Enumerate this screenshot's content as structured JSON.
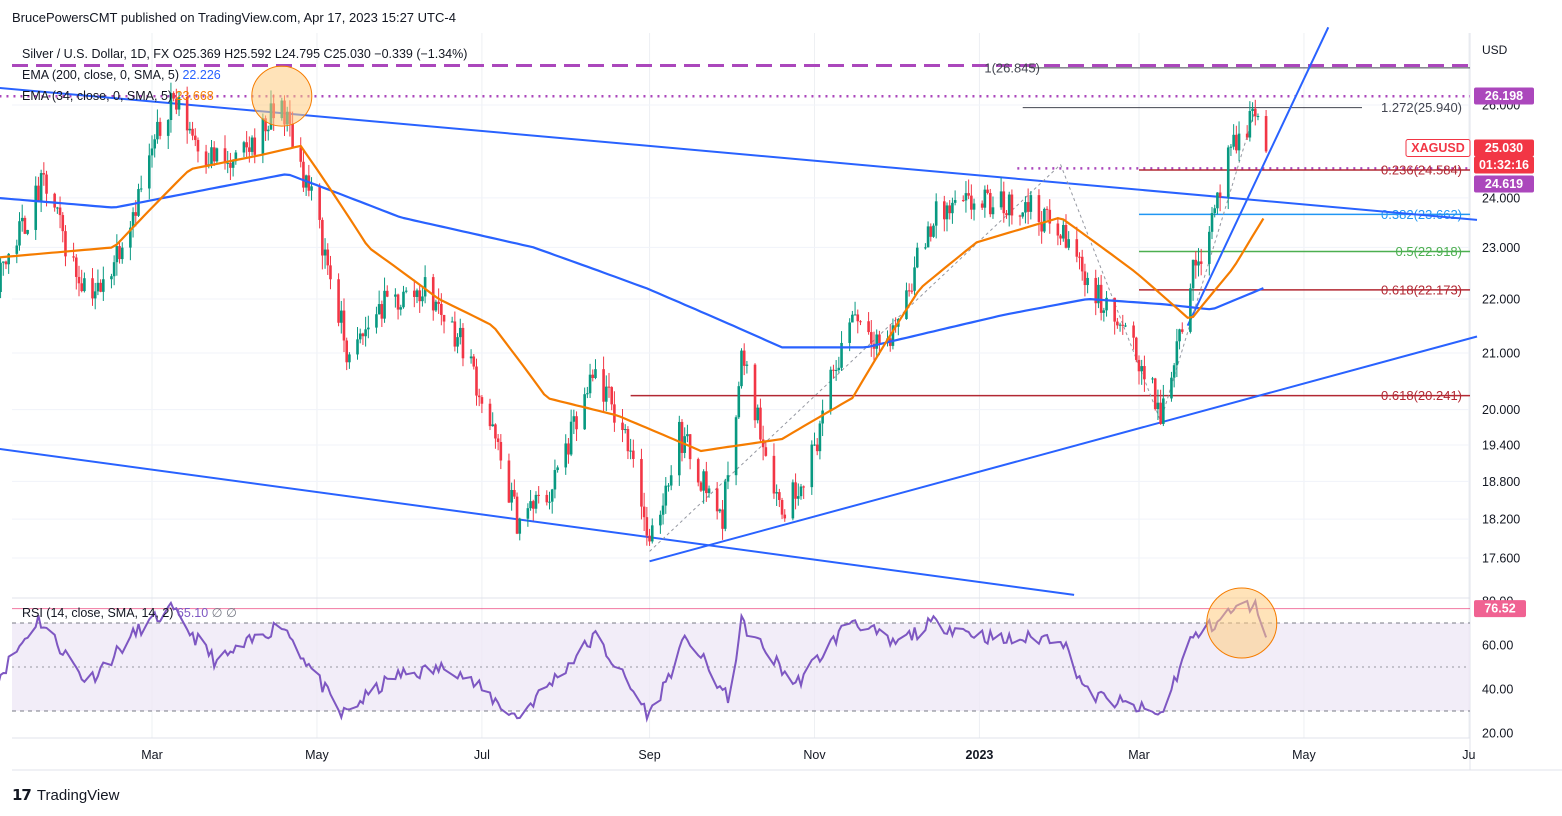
{
  "header": {
    "publisher": "BrucePowersCMT published on TradingView.com, Apr 17, 2023 15:27 UTC-4"
  },
  "branding": {
    "name": "TradingView"
  },
  "colors": {
    "candle_up": "#089981",
    "candle_down": "#f23645",
    "ema200": "#2962ff",
    "ema34": "#f57c00",
    "rsi": "#7e57c2",
    "fib_red": "#b22833",
    "fib_green": "#4caf50",
    "fib_blue": "#2196f3",
    "trend": "#2962ff",
    "magenta": "#ab47bc",
    "highlight": "#ffcc80"
  },
  "chart_data": {
    "type": "candlestick",
    "symbol_line": "Silver / U.S. Dollar, 1D, FX",
    "ohlc_text": {
      "o": "O25.369",
      "h": "H25.592",
      "l": "L24.795",
      "c": "C25.030",
      "chg": "−0.339 (−1.34%)"
    },
    "legend": [
      {
        "label": "EMA (200, close, 0, SMA, 5)",
        "value": "22.226",
        "color": "#2962ff"
      },
      {
        "label": "EMA (34, close, 0, SMA, 5)",
        "value": "23.668",
        "color": "#f57c00"
      }
    ],
    "currency": "USD",
    "price_ticks": [
      "26.000",
      "24.000",
      "23.000",
      "22.000",
      "21.000",
      "20.000",
      "19.400",
      "18.800",
      "18.200",
      "17.600"
    ],
    "price_tick_values": [
      26.0,
      24.0,
      23.0,
      22.0,
      21.0,
      20.0,
      19.4,
      18.8,
      18.2,
      17.6
    ],
    "price_scale": "log",
    "time_labels": [
      "Mar",
      "May",
      "Jul",
      "Sep",
      "Nov",
      "2023",
      "Mar",
      "May",
      "Ju"
    ],
    "time_label_dates": [
      "2022-03-01",
      "2022-05-01",
      "2022-07-01",
      "2022-09-01",
      "2022-11-01",
      "2023-01-01",
      "2023-03-01",
      "2023-05-01",
      "2023-07-01"
    ],
    "close_path": [
      {
        "x": "2022-01-03",
        "y": 22.4
      },
      {
        "x": "2022-01-20",
        "y": 24.3
      },
      {
        "x": "2022-02-01",
        "y": 22.5
      },
      {
        "x": "2022-02-10",
        "y": 22.1
      },
      {
        "x": "2022-02-25",
        "y": 24.2
      },
      {
        "x": "2022-03-08",
        "y": 26.2
      },
      {
        "x": "2022-03-20",
        "y": 25.0
      },
      {
        "x": "2022-03-31",
        "y": 24.6
      },
      {
        "x": "2022-04-18",
        "y": 26.0
      },
      {
        "x": "2022-04-30",
        "y": 23.8
      },
      {
        "x": "2022-05-13",
        "y": 20.8
      },
      {
        "x": "2022-05-23",
        "y": 21.8
      },
      {
        "x": "2022-06-10",
        "y": 22.2
      },
      {
        "x": "2022-06-25",
        "y": 21.1
      },
      {
        "x": "2022-07-14",
        "y": 18.2
      },
      {
        "x": "2022-07-26",
        "y": 18.6
      },
      {
        "x": "2022-08-12",
        "y": 20.6
      },
      {
        "x": "2022-08-26",
        "y": 19.3
      },
      {
        "x": "2022-09-01",
        "y": 17.7
      },
      {
        "x": "2022-09-12",
        "y": 19.6
      },
      {
        "x": "2022-09-28",
        "y": 18.2
      },
      {
        "x": "2022-10-05",
        "y": 20.9
      },
      {
        "x": "2022-10-20",
        "y": 18.3
      },
      {
        "x": "2022-10-31",
        "y": 19.2
      },
      {
        "x": "2022-11-15",
        "y": 21.8
      },
      {
        "x": "2022-11-28",
        "y": 21.1
      },
      {
        "x": "2022-12-15",
        "y": 23.6
      },
      {
        "x": "2022-12-31",
        "y": 23.9
      },
      {
        "x": "2023-01-20",
        "y": 23.8
      },
      {
        "x": "2023-02-03",
        "y": 23.1
      },
      {
        "x": "2023-02-14",
        "y": 22.0
      },
      {
        "x": "2023-02-28",
        "y": 21.0
      },
      {
        "x": "2023-03-09",
        "y": 19.9
      },
      {
        "x": "2023-03-20",
        "y": 22.3
      },
      {
        "x": "2023-04-04",
        "y": 24.9
      },
      {
        "x": "2023-04-13",
        "y": 25.9
      },
      {
        "x": "2023-04-17",
        "y": 25.03
      }
    ],
    "ema34_path": [
      {
        "x": "2022-01-03",
        "y": 22.8
      },
      {
        "x": "2022-02-15",
        "y": 23.0
      },
      {
        "x": "2022-03-15",
        "y": 24.6
      },
      {
        "x": "2022-04-10",
        "y": 24.9
      },
      {
        "x": "2022-04-25",
        "y": 25.1
      },
      {
        "x": "2022-05-20",
        "y": 23.0
      },
      {
        "x": "2022-06-15",
        "y": 22.0
      },
      {
        "x": "2022-07-05",
        "y": 21.5
      },
      {
        "x": "2022-07-25",
        "y": 20.2
      },
      {
        "x": "2022-08-20",
        "y": 19.9
      },
      {
        "x": "2022-09-20",
        "y": 19.3
      },
      {
        "x": "2022-10-20",
        "y": 19.5
      },
      {
        "x": "2022-11-15",
        "y": 20.2
      },
      {
        "x": "2022-12-10",
        "y": 22.2
      },
      {
        "x": "2022-12-31",
        "y": 23.1
      },
      {
        "x": "2023-01-31",
        "y": 23.6
      },
      {
        "x": "2023-02-28",
        "y": 22.5
      },
      {
        "x": "2023-03-20",
        "y": 21.6
      },
      {
        "x": "2023-04-05",
        "y": 22.6
      },
      {
        "x": "2023-04-17",
        "y": 23.668
      }
    ],
    "ema200_path": [
      {
        "x": "2022-01-03",
        "y": 24.0
      },
      {
        "x": "2022-02-15",
        "y": 23.8
      },
      {
        "x": "2022-04-20",
        "y": 24.5
      },
      {
        "x": "2022-06-01",
        "y": 23.6
      },
      {
        "x": "2022-07-20",
        "y": 23.0
      },
      {
        "x": "2022-08-31",
        "y": 22.2
      },
      {
        "x": "2022-10-20",
        "y": 21.1
      },
      {
        "x": "2022-11-20",
        "y": 21.1
      },
      {
        "x": "2023-01-10",
        "y": 21.7
      },
      {
        "x": "2023-02-10",
        "y": 22.0
      },
      {
        "x": "2023-03-10",
        "y": 21.9
      },
      {
        "x": "2023-03-28",
        "y": 21.8
      },
      {
        "x": "2023-04-17",
        "y": 22.226
      }
    ],
    "trend_lines": [
      {
        "from": {
          "x": "2022-01-01",
          "y": 26.4
        },
        "to": {
          "x": "2023-07-04",
          "y": 23.55
        }
      },
      {
        "from": {
          "x": "2022-01-01",
          "y": 19.35
        },
        "to": {
          "x": "2023-02-05",
          "y": 17.05
        }
      },
      {
        "from": {
          "x": "2022-09-01",
          "y": 17.55
        },
        "to": {
          "x": "2023-07-04",
          "y": 21.3
        }
      },
      {
        "from": {
          "x": "2023-03-19",
          "y": 21.5
        },
        "to": {
          "x": "2023-05-10",
          "y": 27.8
        }
      }
    ],
    "horizontal_levels": [
      {
        "label": "1(26.845)",
        "value": 26.845,
        "from": "2023-01-20",
        "style": "gray"
      },
      {
        "label": "1.272(25.940)",
        "value": 25.94,
        "from": "2023-01-17",
        "style": "gray"
      },
      {
        "label": "0.236(24.584)",
        "value": 24.584,
        "from": "2023-03-01",
        "style": "red"
      },
      {
        "label": "0.382(23.662)",
        "value": 23.662,
        "from": "2023-03-01",
        "style": "blue"
      },
      {
        "label": "0.5(22.918)",
        "value": 22.918,
        "from": "2023-03-01",
        "style": "green"
      },
      {
        "label": "0.618(22.173)",
        "value": 22.173,
        "from": "2023-03-01",
        "style": "red"
      },
      {
        "label": "0.618(20.241)",
        "value": 20.241,
        "from": "2022-08-25",
        "style": "red"
      }
    ],
    "dotted_levels": [
      {
        "value": 26.198,
        "from": "2022-01-01"
      },
      {
        "value": 24.619,
        "from": "2023-01-15"
      }
    ],
    "dashed_level": {
      "value": 26.9,
      "from": "2022-01-01"
    },
    "price_badges": [
      {
        "text": "26.198",
        "value": 26.198,
        "style": "magenta"
      },
      {
        "text": "XAGUSD",
        "value": 25.03,
        "style": "outline"
      },
      {
        "text": "25.030",
        "value": 25.03,
        "style": "red"
      },
      {
        "text": "01:32:16",
        "value": 24.8,
        "style": "red"
      },
      {
        "text": "24.619",
        "value": 24.619,
        "style": "magenta"
      }
    ],
    "highlight_circles": [
      {
        "x": "2022-04-18",
        "y": 26.2,
        "pane": "price"
      },
      {
        "x": "2023-04-08",
        "y": 70,
        "pane": "rsi"
      }
    ],
    "rsi": {
      "label": "RSI (14, close, SMA, 14, 2)",
      "value": "65.10",
      "extras": "∅ ∅",
      "badge": "76.52",
      "badge_value": 76.52,
      "ticks": [
        "80.00",
        "60.00",
        "40.00",
        "20.00"
      ],
      "tick_values": [
        80,
        60,
        40,
        20
      ],
      "upper_band": 70,
      "lower_band": 30,
      "middle": 50,
      "path": [
        {
          "x": "2022-01-03",
          "y": 45
        },
        {
          "x": "2022-01-18",
          "y": 72
        },
        {
          "x": "2022-02-05",
          "y": 43
        },
        {
          "x": "2022-02-25",
          "y": 68
        },
        {
          "x": "2022-03-08",
          "y": 76
        },
        {
          "x": "2022-03-25",
          "y": 52
        },
        {
          "x": "2022-04-18",
          "y": 70
        },
        {
          "x": "2022-05-10",
          "y": 28
        },
        {
          "x": "2022-05-30",
          "y": 46
        },
        {
          "x": "2022-06-20",
          "y": 50
        },
        {
          "x": "2022-07-14",
          "y": 27
        },
        {
          "x": "2022-08-12",
          "y": 64
        },
        {
          "x": "2022-09-01",
          "y": 28
        },
        {
          "x": "2022-09-15",
          "y": 64
        },
        {
          "x": "2022-09-30",
          "y": 35
        },
        {
          "x": "2022-10-05",
          "y": 70
        },
        {
          "x": "2022-10-25",
          "y": 42
        },
        {
          "x": "2022-11-15",
          "y": 72
        },
        {
          "x": "2022-11-30",
          "y": 60
        },
        {
          "x": "2022-12-15",
          "y": 70
        },
        {
          "x": "2023-01-10",
          "y": 62
        },
        {
          "x": "2023-01-31",
          "y": 64
        },
        {
          "x": "2023-02-10",
          "y": 38
        },
        {
          "x": "2023-03-09",
          "y": 28
        },
        {
          "x": "2023-03-20",
          "y": 62
        },
        {
          "x": "2023-04-05",
          "y": 76
        },
        {
          "x": "2023-04-13",
          "y": 79
        },
        {
          "x": "2023-04-17",
          "y": 65.1
        }
      ]
    }
  }
}
